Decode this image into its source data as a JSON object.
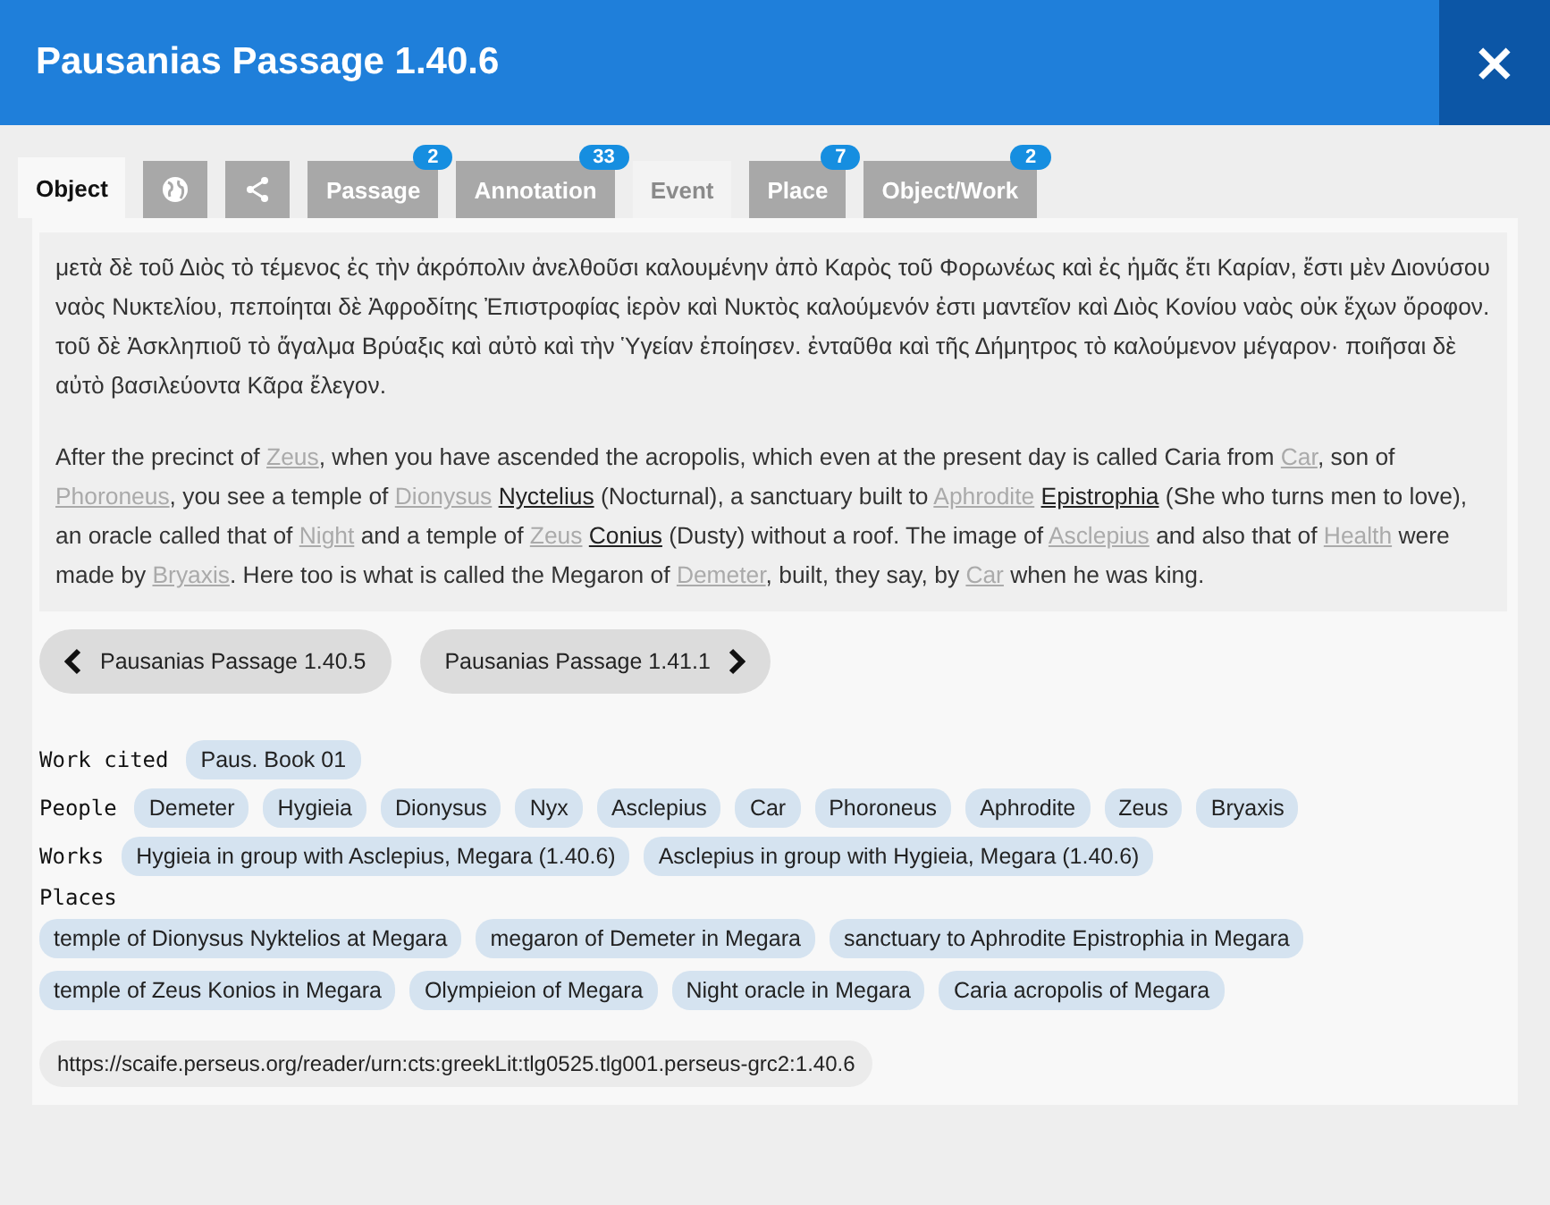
{
  "window": {
    "title": "Pausanias Passage 1.40.6",
    "close": "×"
  },
  "tabs": [
    {
      "kind": "text",
      "label": "Object",
      "selected": true,
      "disabled": false
    },
    {
      "kind": "globe",
      "selected": false,
      "disabled": false
    },
    {
      "kind": "share",
      "selected": false,
      "disabled": false
    },
    {
      "kind": "text",
      "label": "Passage",
      "badge": "2",
      "selected": false,
      "disabled": false
    },
    {
      "kind": "text",
      "label": "Annotation",
      "badge": "33",
      "selected": false,
      "disabled": false
    },
    {
      "kind": "text",
      "label": "Event",
      "selected": false,
      "disabled": true
    },
    {
      "kind": "text",
      "label": "Place",
      "badge": "7",
      "selected": false,
      "disabled": false
    },
    {
      "kind": "text",
      "label": "Object/Work",
      "badge": "2",
      "selected": false,
      "disabled": false
    }
  ],
  "greek_text": "μετὰ δὲ τοῦ Διὸς τὸ τέμενος ἐς τὴν ἀκρόπολιν ἀνελθοῦσι καλουμένην ἀπὸ Καρὸς τοῦ Φορωνέως καὶ ἐς ἡμᾶς ἔτι Καρίαν, ἔστι μὲν Διονύσου ναὸς Νυκτελίου, πεποίηται δὲ Ἀφροδίτης Ἐπιστροφίας ἱερὸν καὶ Νυκτὸς καλούμενόν ἐστι μαντεῖον καὶ Διὸς Κονίου ναὸς οὐκ ἔχων ὄροφον. τοῦ δὲ Ἀσκληπιοῦ τὸ ἄγαλμα Βρύαξις καὶ αὐτὸ καὶ τὴν Ὑγείαν ἐποίησεν. ἐνταῦθα καὶ τῆς Δήμητρος τὸ καλούμενον μέγαρον· ποιῆσαι δὲ αὐτὸ βασιλεύοντα Κᾶρα ἔλεγον.",
  "translation": [
    {
      "kind": "plain",
      "text": "After the precinct of "
    },
    {
      "kind": "link",
      "text": "Zeus"
    },
    {
      "kind": "plain",
      "text": ", when you have ascended the acropolis, which even at the present day is called Caria from "
    },
    {
      "kind": "link",
      "text": "Car"
    },
    {
      "kind": "plain",
      "text": ", son of "
    },
    {
      "kind": "link",
      "text": "Phoroneus"
    },
    {
      "kind": "plain",
      "text": ", you see a temple of "
    },
    {
      "kind": "link",
      "text": "Dionysus"
    },
    {
      "kind": "term",
      "text": "Nyctelius"
    },
    {
      "kind": "plain",
      "text": " (Nocturnal), a sanctuary built to "
    },
    {
      "kind": "link",
      "text": "Aphrodite"
    },
    {
      "kind": "term",
      "text": "Epistrophia"
    },
    {
      "kind": "plain",
      "text": " (She who turns men to love), an oracle called that of "
    },
    {
      "kind": "link",
      "text": "Night"
    },
    {
      "kind": "plain",
      "text": " and a temple of "
    },
    {
      "kind": "link",
      "text": "Zeus"
    },
    {
      "kind": "term",
      "text": "Conius"
    },
    {
      "kind": "plain",
      "text": " (Dusty) without a roof. The image of "
    },
    {
      "kind": "link",
      "text": "Asclepius"
    },
    {
      "kind": "plain",
      "text": " and also that of "
    },
    {
      "kind": "link",
      "text": "Health"
    },
    {
      "kind": "plain",
      "text": " were made by "
    },
    {
      "kind": "link",
      "text": "Bryaxis"
    },
    {
      "kind": "plain",
      "text": ". Here too is what is called the Megaron of "
    },
    {
      "kind": "link",
      "text": "Demeter"
    },
    {
      "kind": "plain",
      "text": ", built, they say, by "
    },
    {
      "kind": "link",
      "text": "Car"
    },
    {
      "kind": "plain",
      "text": " when he was king."
    }
  ],
  "nav": {
    "previous": "Pausanias Passage 1.40.5",
    "next": "Pausanias Passage 1.41.1"
  },
  "work_cited": {
    "label": "Work cited",
    "items": [
      "Paus. Book 01"
    ]
  },
  "people": {
    "label": "People",
    "items": [
      "Demeter",
      "Hygieia",
      "Dionysus",
      "Nyx",
      "Asclepius",
      "Car",
      "Phoroneus",
      "Aphrodite",
      "Zeus",
      "Bryaxis"
    ]
  },
  "works": {
    "label": "Works",
    "items": [
      "Hygieia in group with Asclepius, Megara (1.40.6)",
      "Asclepius in group with Hygieia, Megara (1.40.6)"
    ]
  },
  "places": {
    "label": "Places",
    "items": [
      "temple of Dionysus Nyktelios at Megara",
      "megaron of Demeter in Megara",
      "sanctuary to Aphrodite Epistrophia in Megara",
      "temple of Zeus Konios in Megara",
      "Olympieion of Megara",
      "Night oracle in Megara",
      "Caria acropolis of Megara"
    ]
  },
  "url": "https://scaife.perseus.org/reader/urn:cts:greekLit:tlg0525.tlg001.perseus-grc2:1.40.6"
}
